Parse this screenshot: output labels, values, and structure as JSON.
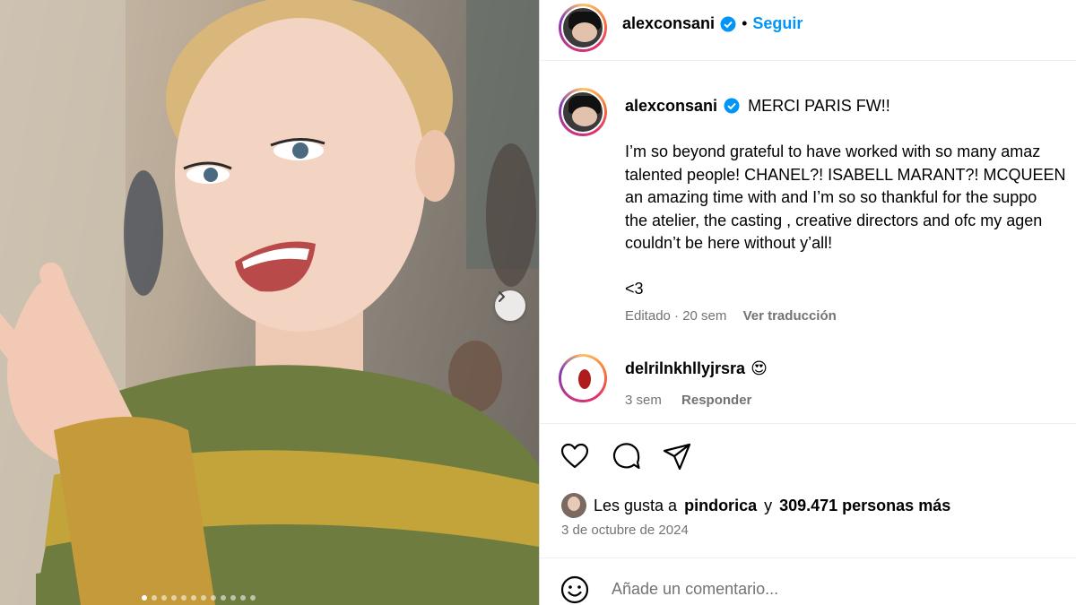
{
  "post": {
    "author": "alexconsani",
    "follow_label": "Seguir",
    "separator": "•",
    "caption_lines": [
      "MERCI PARIS FW!!",
      "",
      "I’m so beyond grateful to have worked with so many amaz",
      "talented people! CHANEL?! ISABELL MARANT?! MCQUEEN",
      "an amazing time with and I’m so so thankful for the suppo",
      "the atelier, the casting , creative directors and ofc my agen",
      "couldn’t be here without y’all!",
      "",
      "<3"
    ],
    "caption_meta": {
      "edited": "Editado · 20 sem",
      "translate": "Ver traducción"
    },
    "carousel": {
      "total_slides": 12,
      "active_slide": 1
    }
  },
  "comment": {
    "user": "delrilnkhllyjrsra",
    "emoji": "😍",
    "time": "3 sem",
    "reply": "Responder"
  },
  "likes": {
    "prefix": "Les gusta a",
    "user": "pindorica",
    "conj": "y",
    "count_text": "309.471 personas más"
  },
  "date": "3 de octubre de 2024",
  "comment_box": {
    "placeholder": "Añade un comentario..."
  },
  "colors": {
    "verified": "#0095f6",
    "link": "#0095f6",
    "meta_text": "#737373"
  },
  "icons": [
    "chevron-right-icon",
    "verified-badge-icon",
    "heart-icon",
    "comment-icon",
    "share-icon",
    "emoji-icon"
  ]
}
